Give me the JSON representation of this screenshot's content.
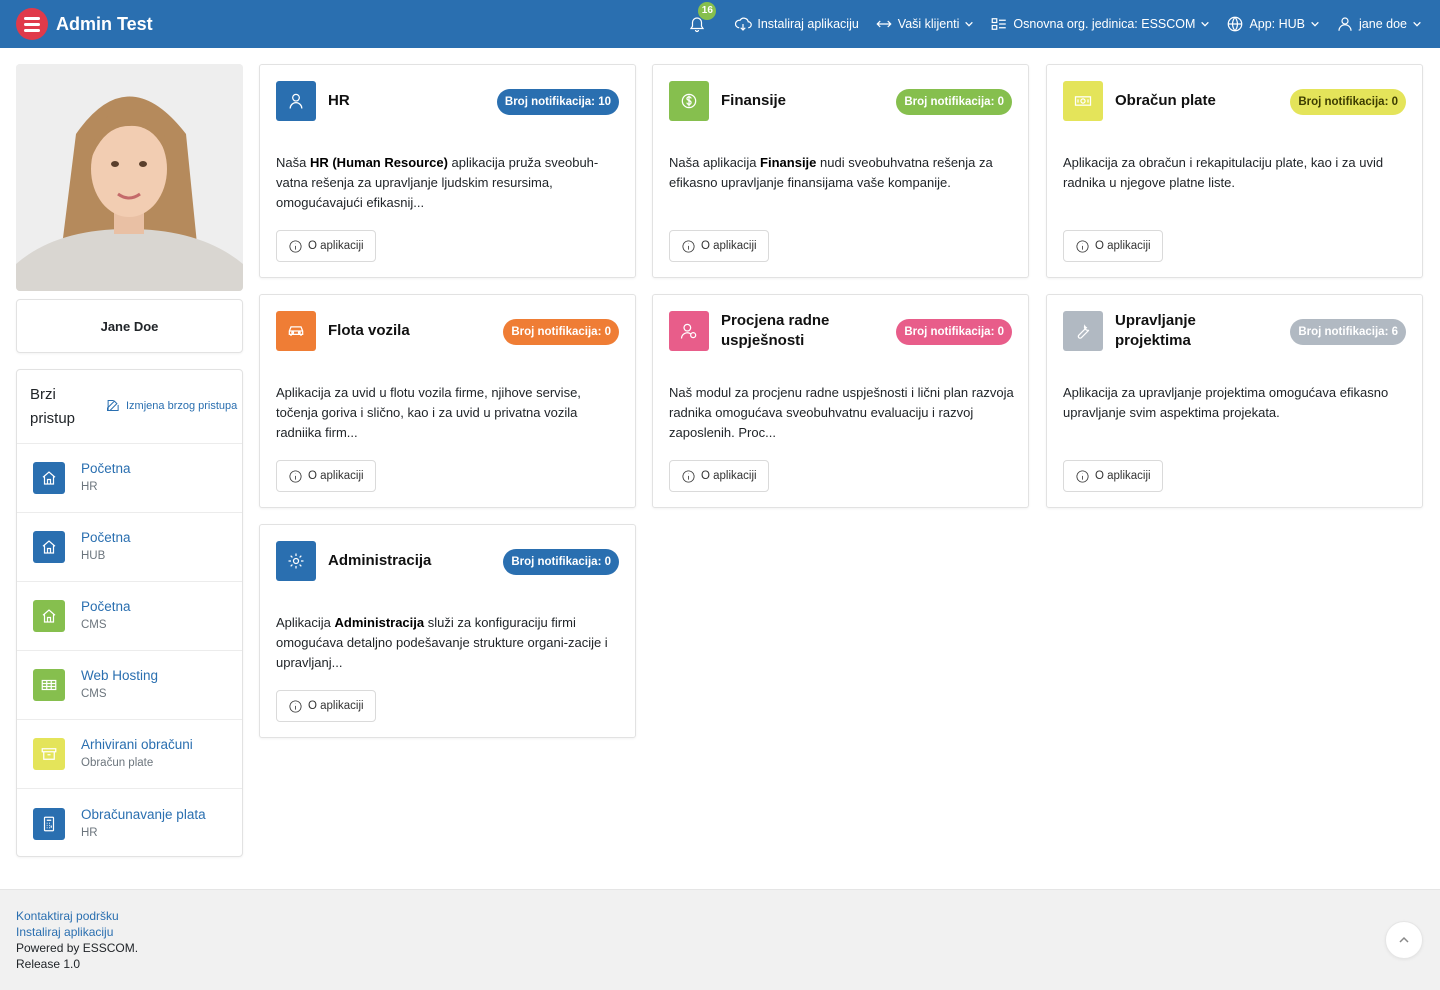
{
  "header": {
    "title": "Admin Test",
    "notifications_count": "16",
    "install_app": "Instaliraj aplikaciju",
    "clients": "Vaši klijenti",
    "org_unit": "Osnovna org. jedinica: ESSCOM",
    "app": "App: HUB",
    "user": "jane doe"
  },
  "profile": {
    "name": "Jane Doe"
  },
  "quick_access": {
    "title": "Brzi pristup",
    "edit_label": "Izmjena brzog pristupa",
    "items": [
      {
        "label": "Početna",
        "sub": "HR",
        "color": "#2a6fb0",
        "icon": "home-icon"
      },
      {
        "label": "Početna",
        "sub": "HUB",
        "color": "#2a6fb0",
        "icon": "home-icon"
      },
      {
        "label": "Početna",
        "sub": "CMS",
        "color": "#86bf4e",
        "icon": "home-icon"
      },
      {
        "label": "Web Hosting",
        "sub": "CMS",
        "color": "#86bf4e",
        "icon": "table-icon"
      },
      {
        "label": "Arhivirani obračuni",
        "sub": "Obračun plate",
        "color": "#e4e45a",
        "icon": "archive-icon"
      },
      {
        "label": "Obračunavanje plata",
        "sub": "HR",
        "color": "#2a6fb0",
        "icon": "calculator-icon"
      }
    ]
  },
  "apps": [
    {
      "title": "HR",
      "badge": "Broj notifikacija: 10",
      "color": "#2a6fb0",
      "badge_color": "#2a6fb0",
      "icon": "user-icon",
      "desc_pre": "Naša ",
      "desc_bold": "HR (Human Resource)",
      "desc_post": " aplikacija pruža sveobuh-vatna rešenja za upravljanje ljudskim resursima, omogućavajući efikasnij...",
      "button": "O aplikaciji"
    },
    {
      "title": "Finansije",
      "badge": "Broj notifikacija: 0",
      "color": "#86bf4e",
      "badge_color": "#86bf4e",
      "icon": "dollar-icon",
      "desc_pre": "Naša aplikacija ",
      "desc_bold": "Finansije",
      "desc_post": " nudi sveobuhvatna rešenja za efikasno upravljanje finansijama vaše kompanije.",
      "button": "O aplikaciji"
    },
    {
      "title": "Obračun plate",
      "badge": "Broj notifikacija: 0",
      "color": "#e4e45a",
      "badge_color": "#e4e45a",
      "icon": "money-icon",
      "desc_pre": "Aplikacija za obračun i rekapitulaciju plate, kao i za uvid radnika u njegove platne liste.",
      "desc_bold": "",
      "desc_post": "",
      "button": "O aplikaciji"
    },
    {
      "title": "Flota vozila",
      "badge": "Broj notifikacija: 0",
      "color": "#ef7d35",
      "badge_color": "#ef7d35",
      "icon": "car-icon",
      "desc_pre": "Aplikacija za uvid u flotu vozila firme, njihove servise, točenja goriva i slično, kao i za uvid u privatna vozila radniika firm...",
      "desc_bold": "",
      "desc_post": "",
      "button": "O aplikaciji"
    },
    {
      "title": "Procjena radne uspješnosti",
      "badge": "Broj notifikacija: 0",
      "color": "#e85d8a",
      "badge_color": "#e85d8a",
      "icon": "user-check-icon",
      "desc_pre": "Naš modul za procjenu radne uspješnosti i lični plan razvoja radnika omogućava sveobuhvatnu evaluaciju i razvoj zaposlenih. Proc...",
      "desc_bold": "",
      "desc_post": "",
      "button": "O aplikaciji"
    },
    {
      "title": "Upravljanje projektima",
      "badge": "Broj notifikacija: 6",
      "color": "#b1b9c2",
      "badge_color": "#b1b9c2",
      "icon": "wrench-icon",
      "desc_pre": "Aplikacija za upravljanje projektima omogućava efikasno upravljanje svim aspektima projekata.",
      "desc_bold": "",
      "desc_post": "",
      "button": "O aplikaciji"
    },
    {
      "title": "Administracija",
      "badge": "Broj notifikacija: 0",
      "color": "#2a6fb0",
      "badge_color": "#2a6fb0",
      "icon": "gear-icon",
      "desc_pre": "Aplikacija ",
      "desc_bold": "Administracija",
      "desc_post": " služi za konfiguraciju firmi omogućava detaljno podešavanje strukture organi-zacije i upravljanj...",
      "button": "O aplikaciji"
    }
  ],
  "footer": {
    "contact": "Kontaktiraj podršku",
    "install": "Instaliraj aplikaciju",
    "powered": "Powered by ESSCOM.",
    "release": "Release 1.0"
  }
}
